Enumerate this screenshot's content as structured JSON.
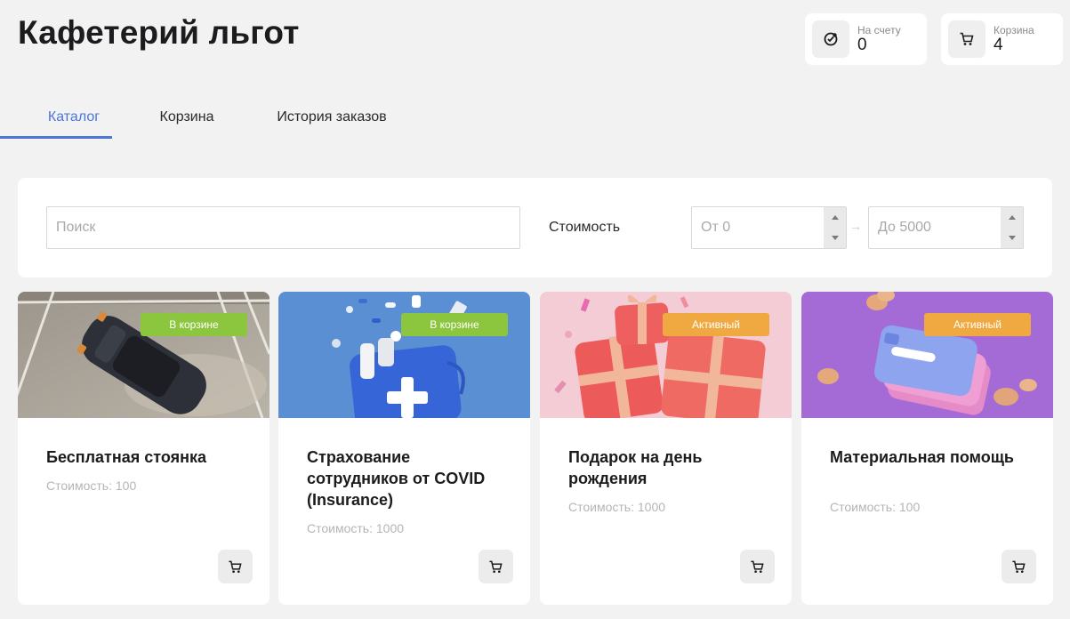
{
  "page": {
    "title": "Кафетерий льгот"
  },
  "balance": {
    "label": "На счету",
    "value": "0",
    "icon": "wallet-badge-icon"
  },
  "cart_summary": {
    "label": "Корзина",
    "value": "4",
    "icon": "cart-icon"
  },
  "tabs": [
    {
      "label": "Каталог",
      "active": true
    },
    {
      "label": "Корзина",
      "active": false
    },
    {
      "label": "История заказов",
      "active": false
    }
  ],
  "filters": {
    "search_placeholder": "Поиск",
    "price_label": "Стоимость",
    "from_placeholder": "От 0",
    "to_placeholder": "До 5000",
    "arrow": "→"
  },
  "colors": {
    "accent": "#4d76d6",
    "badge_in_cart": "#8cc63f",
    "badge_active": "#f0a840"
  },
  "cards": [
    {
      "title": "Бесплатная стоянка",
      "price": "Стоимость: 100",
      "badge": "В корзине",
      "badge_type": "in_cart",
      "image": "parking-car-image"
    },
    {
      "title": "Страхование сотрудников от COVID (Insurance)",
      "price": "Стоимость: 1000",
      "badge": "В корзине",
      "badge_type": "in_cart",
      "image": "medical-kit-image"
    },
    {
      "title": "Подарок на день рождения",
      "price": "Стоимость: 1000",
      "badge": "Активный",
      "badge_type": "active",
      "image": "gift-boxes-image"
    },
    {
      "title": "Материальная помощь",
      "price": "Стоимость: 100",
      "badge": "Активный",
      "badge_type": "active",
      "image": "card-coins-image"
    }
  ]
}
